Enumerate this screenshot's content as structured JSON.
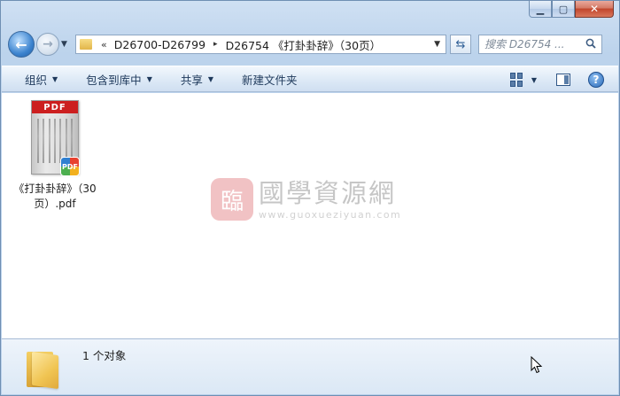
{
  "window": {
    "caption_buttons": {
      "minimize": "▭",
      "maximize": "□",
      "close": "✕"
    }
  },
  "nav": {
    "back_icon": "back-arrow-icon",
    "forward_icon": "forward-arrow-icon",
    "address": {
      "overflow": "«",
      "crumbs": [
        "D26700-D26799",
        "D26754 《打卦卦辞》（30页）"
      ],
      "separator": "▸"
    },
    "search": {
      "placeholder": "搜索 D26754 ..."
    }
  },
  "toolbar": {
    "organize": "组织",
    "include_in_library": "包含到库中",
    "share": "共享",
    "new_folder": "新建文件夹",
    "help": "?"
  },
  "files": [
    {
      "name": "《打卦卦辞》（30页）.pdf",
      "thumb_label": "PDF",
      "badge_label": "PDF"
    }
  ],
  "watermark": {
    "logo_char": "臨",
    "title": "國學資源網",
    "url": "www.guoxueziyuan.com"
  },
  "status": {
    "count_text": "1 个对象"
  },
  "colors": {
    "pdf_red": "#cc1f1f",
    "toolbar_text": "#1e395b",
    "window_frame": "#b9d0ea"
  }
}
